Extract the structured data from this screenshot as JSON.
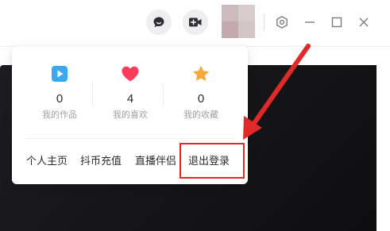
{
  "titlebar": {
    "buttons": [
      {
        "name": "message",
        "icon": "chat-bubble-icon"
      },
      {
        "name": "upload",
        "icon": "video-plus-icon"
      }
    ],
    "window_controls": [
      {
        "icon": "settings-hexagon-icon"
      },
      {
        "icon": "minimize-icon"
      },
      {
        "icon": "maximize-icon"
      },
      {
        "icon": "close-icon"
      }
    ]
  },
  "profile_menu": {
    "stats": [
      {
        "icon": "play-square-icon",
        "count": "0",
        "label": "我的作品",
        "color": "#3aa9ef"
      },
      {
        "icon": "heart-icon",
        "count": "4",
        "label": "我的喜欢",
        "color": "#ff3b5c"
      },
      {
        "icon": "star-icon",
        "count": "0",
        "label": "我的收藏",
        "color": "#f7a93b"
      }
    ],
    "links": [
      {
        "label": "个人主页"
      },
      {
        "label": "抖币充值"
      },
      {
        "label": "直播伴侣"
      },
      {
        "label": "退出登录"
      }
    ]
  },
  "annotation": {
    "color": "#e02a2a"
  }
}
